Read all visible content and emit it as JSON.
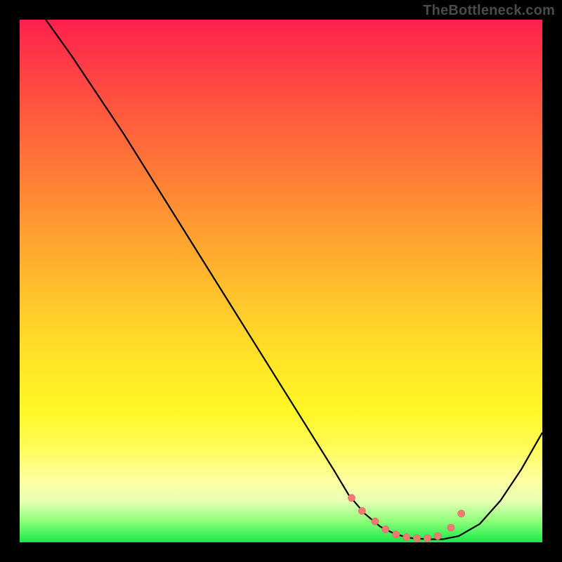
{
  "watermark": "TheBottleneck.com",
  "colors": {
    "background": "#000000",
    "curve_stroke": "#000000",
    "marker_fill": "#ef7a72",
    "marker_stroke": "#d9635c"
  },
  "chart_data": {
    "type": "line",
    "title": "",
    "xlabel": "",
    "ylabel": "",
    "xlim": [
      0,
      100
    ],
    "ylim": [
      0,
      100
    ],
    "grid": false,
    "series": [
      {
        "name": "bottleneck-curve",
        "x": [
          5,
          10,
          15,
          20,
          25,
          30,
          35,
          40,
          45,
          50,
          55,
          60,
          63,
          66,
          69,
          72,
          75,
          78,
          81,
          84,
          88,
          92,
          96,
          100
        ],
        "y": [
          100,
          93,
          85.5,
          78,
          70,
          62,
          54,
          46,
          38,
          30,
          22,
          14,
          9,
          5.5,
          3,
          1.5,
          0.8,
          0.6,
          0.6,
          1.2,
          3.5,
          8,
          14,
          21
        ]
      }
    ],
    "markers": {
      "name": "valley-dots",
      "x": [
        63.5,
        65.5,
        68,
        70,
        72,
        74,
        76,
        78,
        80,
        82.5,
        84.5
      ],
      "y": [
        8.5,
        6,
        4,
        2.5,
        1.5,
        1,
        0.8,
        0.8,
        1.2,
        2.8,
        5.5
      ]
    }
  }
}
